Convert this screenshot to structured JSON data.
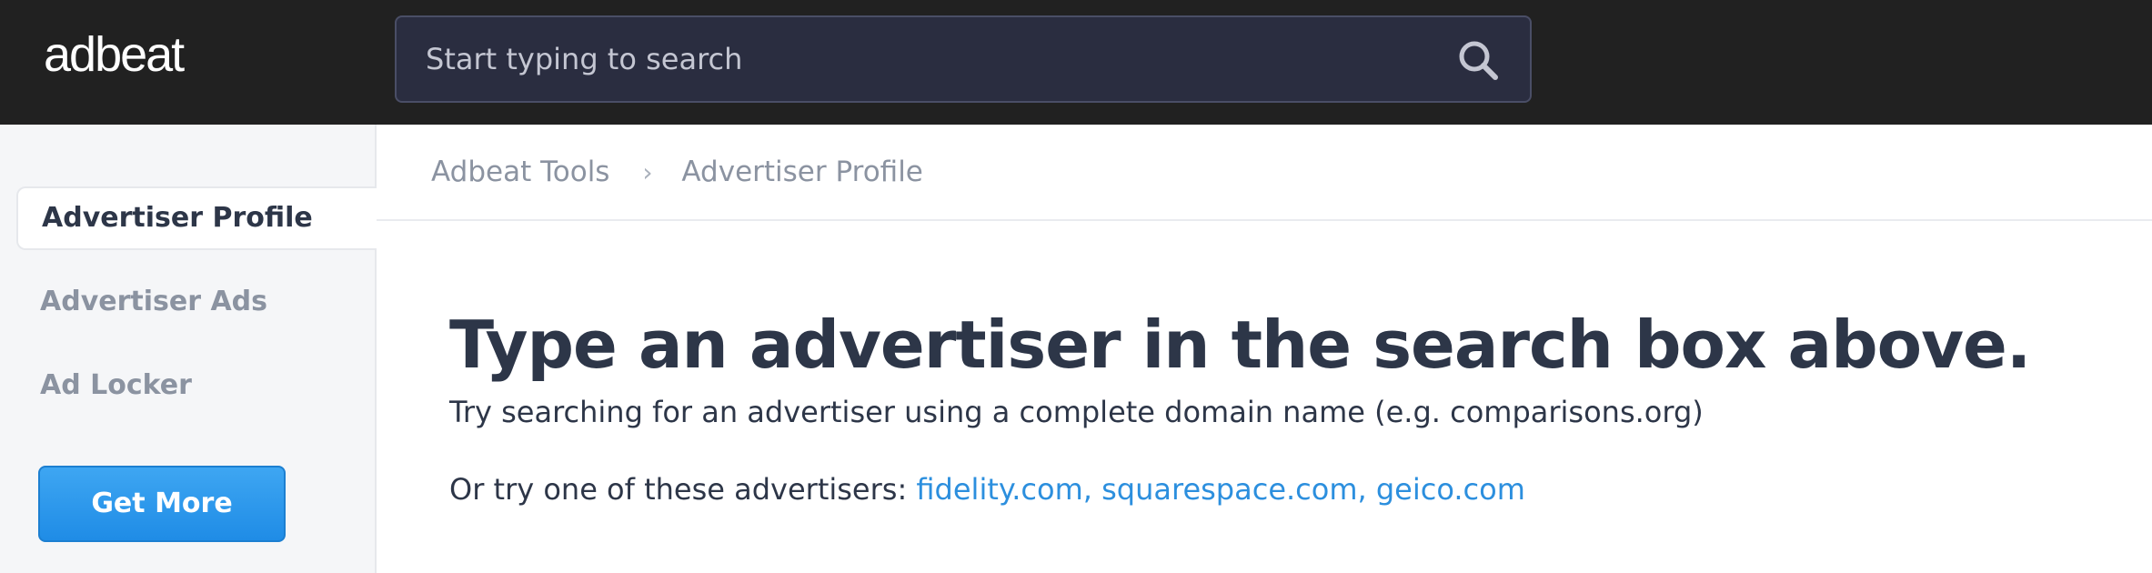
{
  "header": {
    "logo": "adbeat",
    "search": {
      "placeholder": "Start typing to search",
      "value": ""
    }
  },
  "sidebar": {
    "items": [
      {
        "label": "Advertiser Profile",
        "active": true
      },
      {
        "label": "Advertiser Ads",
        "active": false
      },
      {
        "label": "Ad Locker",
        "active": false
      }
    ],
    "cta_label": "Get More"
  },
  "breadcrumb": {
    "items": [
      "Adbeat Tools",
      "Advertiser Profile"
    ],
    "separator": "›"
  },
  "main": {
    "headline": "Type an advertiser in the search box above.",
    "subtext": "Try searching for an advertiser using a complete domain name (e.g. comparisons.org)",
    "suggestions_prefix": "Or try one of these advertisers:",
    "suggestions": [
      "fidelity.com",
      "squarespace.com",
      "geico.com"
    ]
  },
  "colors": {
    "topbar": "#212121",
    "search_bg": "#2a2d40",
    "accent_blue": "#2c8fde",
    "button_blue": "#1f8ce6",
    "text_dark": "#2d3648",
    "text_muted": "#8b93a1"
  },
  "icons": {
    "search": "search-icon",
    "breadcrumb_separator": "chevron-right-icon"
  }
}
